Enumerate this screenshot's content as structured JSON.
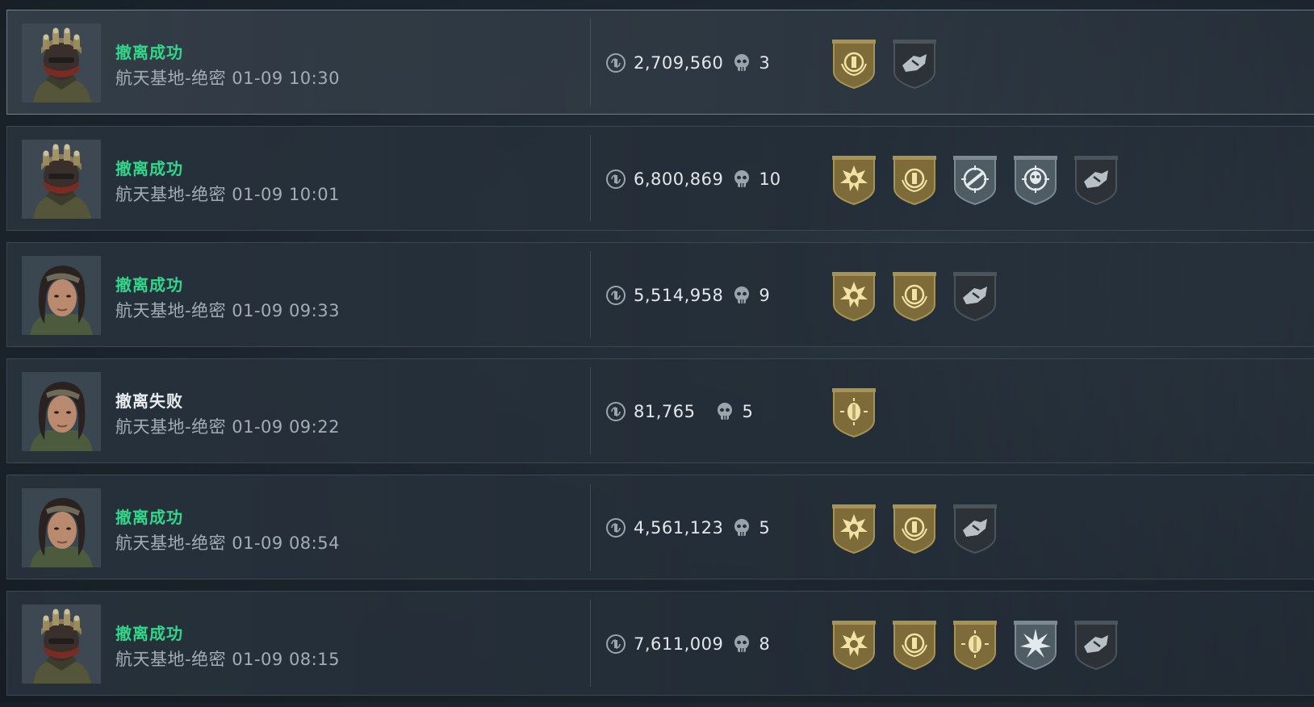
{
  "matches": [
    {
      "status": "撤离成功",
      "outcome": "success",
      "meta": "航天基地-绝密 01-09 10:30",
      "money": "2,709,560",
      "kills": "3",
      "avatar": "helmet-operator",
      "badges": [
        "gold-wreath-badge",
        "gray-vault-badge"
      ]
    },
    {
      "status": "撤离成功",
      "outcome": "success",
      "meta": "航天基地-绝密 01-09 10:01",
      "money": "6,800,869",
      "kills": "10",
      "avatar": "helmet-operator",
      "badges": [
        "gold-sunburst-badge",
        "gold-wreath-badge",
        "silver-crosshair-rifle-badge",
        "silver-crosshair-skull-badge",
        "gray-vault-badge"
      ]
    },
    {
      "status": "撤离成功",
      "outcome": "success",
      "meta": "航天基地-绝密 01-09 09:33",
      "money": "5,514,958",
      "kills": "9",
      "avatar": "female-operator",
      "badges": [
        "gold-sunburst-badge",
        "gold-wreath-badge",
        "gray-vault-badge"
      ]
    },
    {
      "status": "撤离失败",
      "outcome": "fail",
      "meta": "航天基地-绝密 01-09 09:22",
      "money": "81,765",
      "kills": "5",
      "avatar": "female-operator",
      "badges": [
        "gold-head-target-badge"
      ]
    },
    {
      "status": "撤离成功",
      "outcome": "success",
      "meta": "航天基地-绝密 01-09 08:54",
      "money": "4,561,123",
      "kills": "5",
      "avatar": "female-operator",
      "badges": [
        "gold-sunburst-badge",
        "gold-wreath-badge",
        "gray-vault-badge"
      ]
    },
    {
      "status": "撤离成功",
      "outcome": "success",
      "meta": "航天基地-绝密 01-09 08:15",
      "money": "7,611,009",
      "kills": "8",
      "avatar": "helmet-operator",
      "badges": [
        "gold-sunburst-badge",
        "gold-wreath-badge",
        "gold-head-target-badge",
        "silver-burst-badge",
        "gray-vault-badge"
      ]
    }
  ],
  "colors": {
    "success": "#2fd78a",
    "fail": "#e8ecef",
    "gold_badge": "#8a7a45",
    "silver_badge": "#56636b",
    "gray_badge": "#2f353a"
  }
}
